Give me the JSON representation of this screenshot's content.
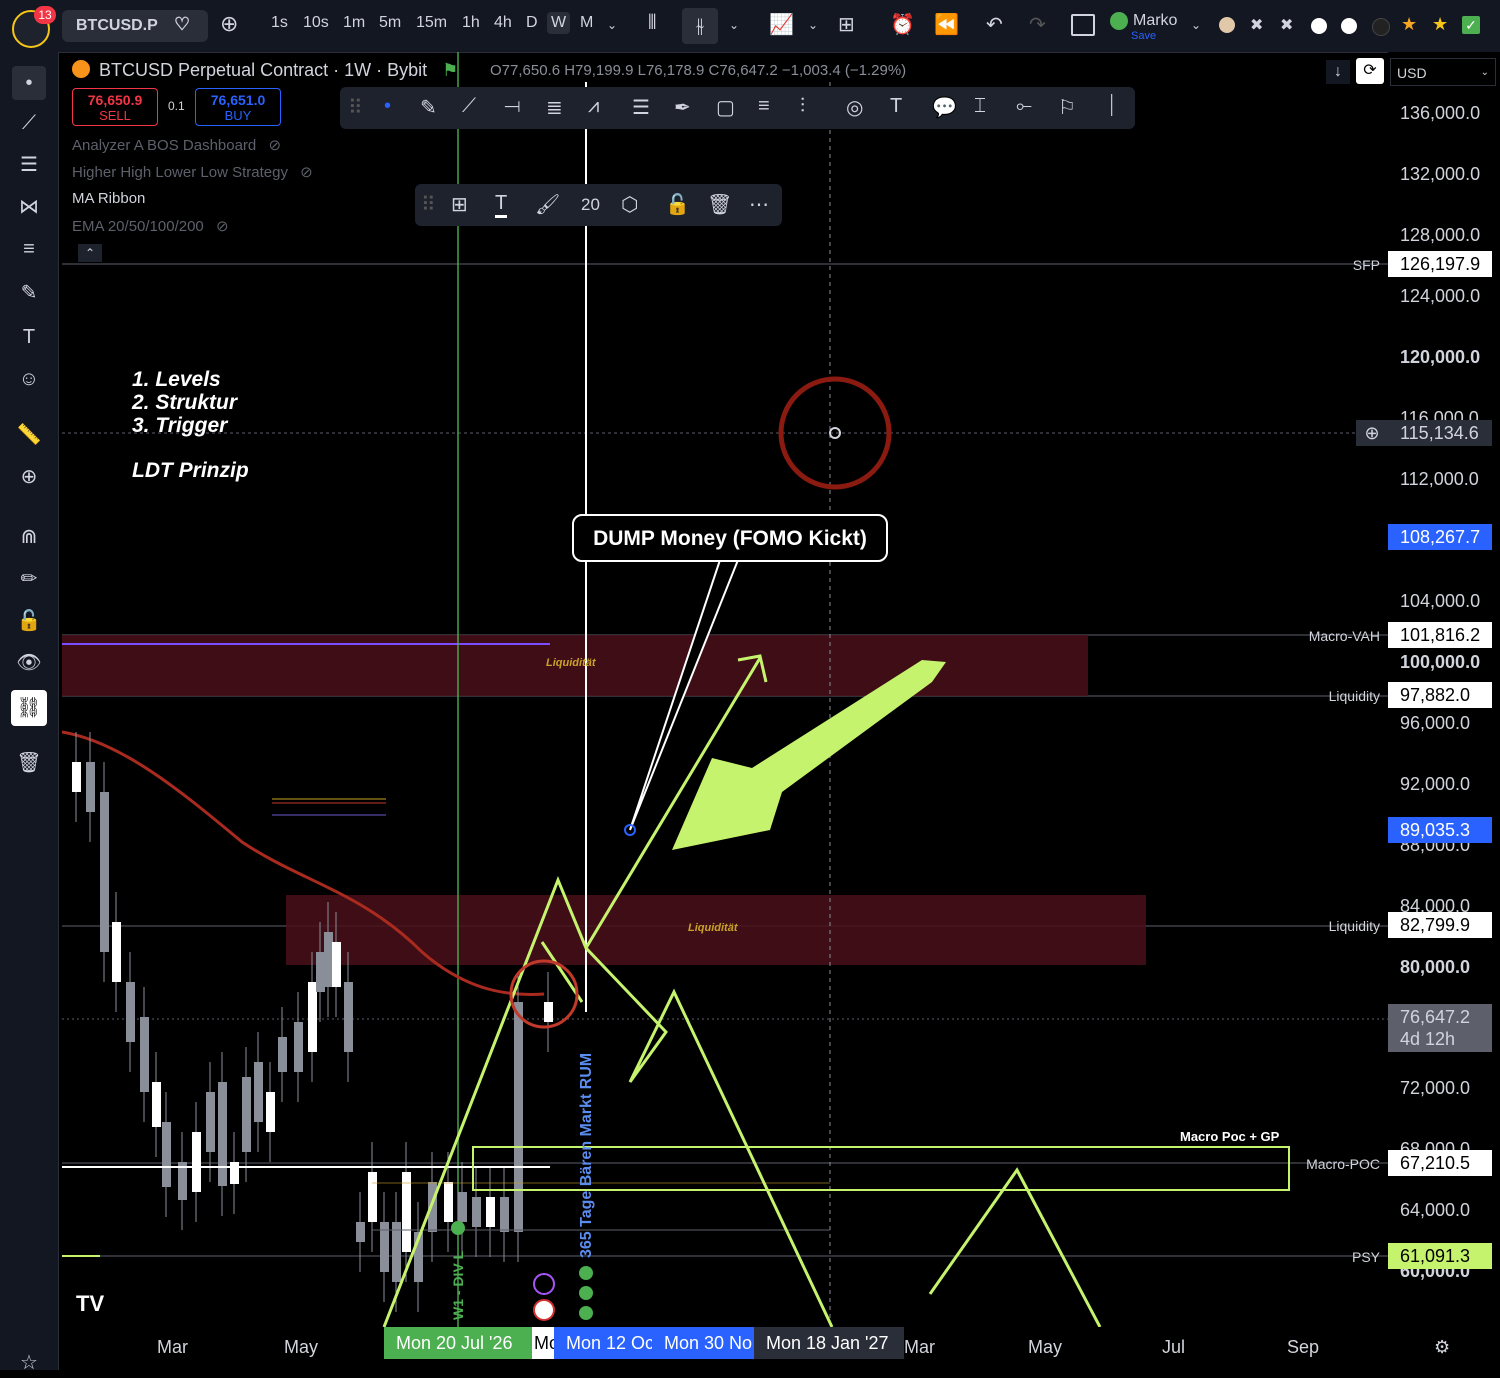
{
  "topbar": {
    "notifications": "13",
    "symbol": "BTCUSD.P",
    "timeframes": [
      "1s",
      "10s",
      "1m",
      "5m",
      "15m",
      "1h",
      "4h",
      "D",
      "W",
      "M"
    ],
    "active_timeframe": "W",
    "user_name": "Marko",
    "save_label": "Save"
  },
  "legend": {
    "title": "BTCUSD Perpetual Contract · 1W · Bybit",
    "ohlc": "O77,650.6 H79,199.9 L76,178.9 C76,647.2 −1,003.4 (−1.29%)",
    "sell_price": "76,650.9",
    "sell_label": "SELL",
    "spread": "0.1",
    "buy_price": "76,651.0",
    "buy_label": "BUY",
    "currency": "USD"
  },
  "indicators": [
    "Analyzer A BOS Dashboard",
    "Higher High Lower Low Strategy",
    "MA Ribbon",
    "EMA 20/50/100/200"
  ],
  "float_toolbar": {
    "size": "20"
  },
  "notes": {
    "line1": "1. Levels",
    "line2": "2. Struktur",
    "line3": "3. Trigger",
    "line4": "LDT Prinzip"
  },
  "callout": "DUMP Money (FOMO Kickt)",
  "zone_label_1": "Liquidität",
  "zone_label_2": "Liquidität",
  "box_label": "Macro Poc + GP",
  "vertical_text_1": "W1 - DIV L",
  "vertical_text_2": "365 Tage Bären Markt RUM",
  "price_axis": {
    "ticks": [
      "136,000.0",
      "132,000.0",
      "128,000.0",
      "124,000.0",
      "120,000.0",
      "116,000.0",
      "112,000.0",
      "104,000.0",
      "100,000.0",
      "96,000.0",
      "92,000.0",
      "88,000.0",
      "84,000.0",
      "80,000.0",
      "72,000.0",
      "68,000.0",
      "64,000.0",
      "60,000.0"
    ],
    "tags": {
      "sfp": {
        "name": "SFP",
        "value": "126,197.9"
      },
      "crosshair": "115,134.6",
      "blue1": "108,267.7",
      "macro_vah": {
        "name": "Macro-VAH",
        "value": "101,816.2"
      },
      "liq1": {
        "name": "Liquidity",
        "value": "97,882.0"
      },
      "blue2": "89,035.3",
      "liq2": {
        "name": "Liquidity",
        "value": "82,799.9"
      },
      "last": "76,647.2",
      "countdown": "4d 12h",
      "macro_poc": {
        "name": "Macro-POC",
        "value": "67,210.5"
      },
      "psy": {
        "name": "PSY",
        "value": "61,091.3"
      }
    }
  },
  "time_axis": {
    "labels": [
      "Mar",
      "May",
      "Mar",
      "May",
      "Jul",
      "Sep"
    ],
    "tag1": "Mon 20 Jul '26",
    "tag2": "Mon 12 Oc",
    "tag3": "Mon 30 No",
    "tag4": "Mon 18 Jan '27"
  },
  "colors": {
    "accent_blue": "#2962ff",
    "annotation_green": "#c6f36d",
    "zone_red": "#4a0f1a",
    "ma_red": "#c0392b"
  }
}
